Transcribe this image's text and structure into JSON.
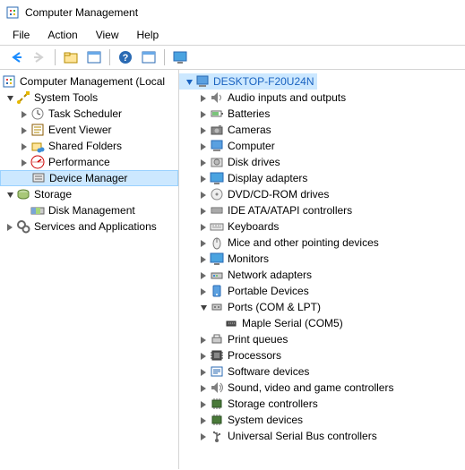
{
  "window": {
    "title": "Computer Management"
  },
  "menu": {
    "file": "File",
    "action": "Action",
    "view": "View",
    "help": "Help"
  },
  "left_tree": {
    "root": {
      "label": "Computer Management (Local"
    },
    "system_tools": {
      "label": "System Tools",
      "children": {
        "task_scheduler": "Task Scheduler",
        "event_viewer": "Event Viewer",
        "shared_folders": "Shared Folders",
        "performance": "Performance",
        "device_manager": "Device Manager"
      }
    },
    "storage": {
      "label": "Storage",
      "children": {
        "disk_management": "Disk Management"
      }
    },
    "services": {
      "label": "Services and Applications"
    }
  },
  "right_tree": {
    "root": {
      "label": "DESKTOP-F20U24N"
    },
    "nodes": {
      "audio": "Audio inputs and outputs",
      "batteries": "Batteries",
      "cameras": "Cameras",
      "computer": "Computer",
      "disk": "Disk drives",
      "display": "Display adapters",
      "dvd": "DVD/CD-ROM drives",
      "ide": "IDE ATA/ATAPI controllers",
      "keyboards": "Keyboards",
      "mice": "Mice and other pointing devices",
      "monitors": "Monitors",
      "network": "Network adapters",
      "portable": "Portable Devices",
      "ports": "Ports (COM & LPT)",
      "maple": "Maple Serial (COM5)",
      "printq": "Print queues",
      "processors": "Processors",
      "software": "Software devices",
      "sound": "Sound, video and game controllers",
      "storagec": "Storage controllers",
      "systemd": "System devices",
      "usb": "Universal Serial Bus controllers"
    }
  }
}
